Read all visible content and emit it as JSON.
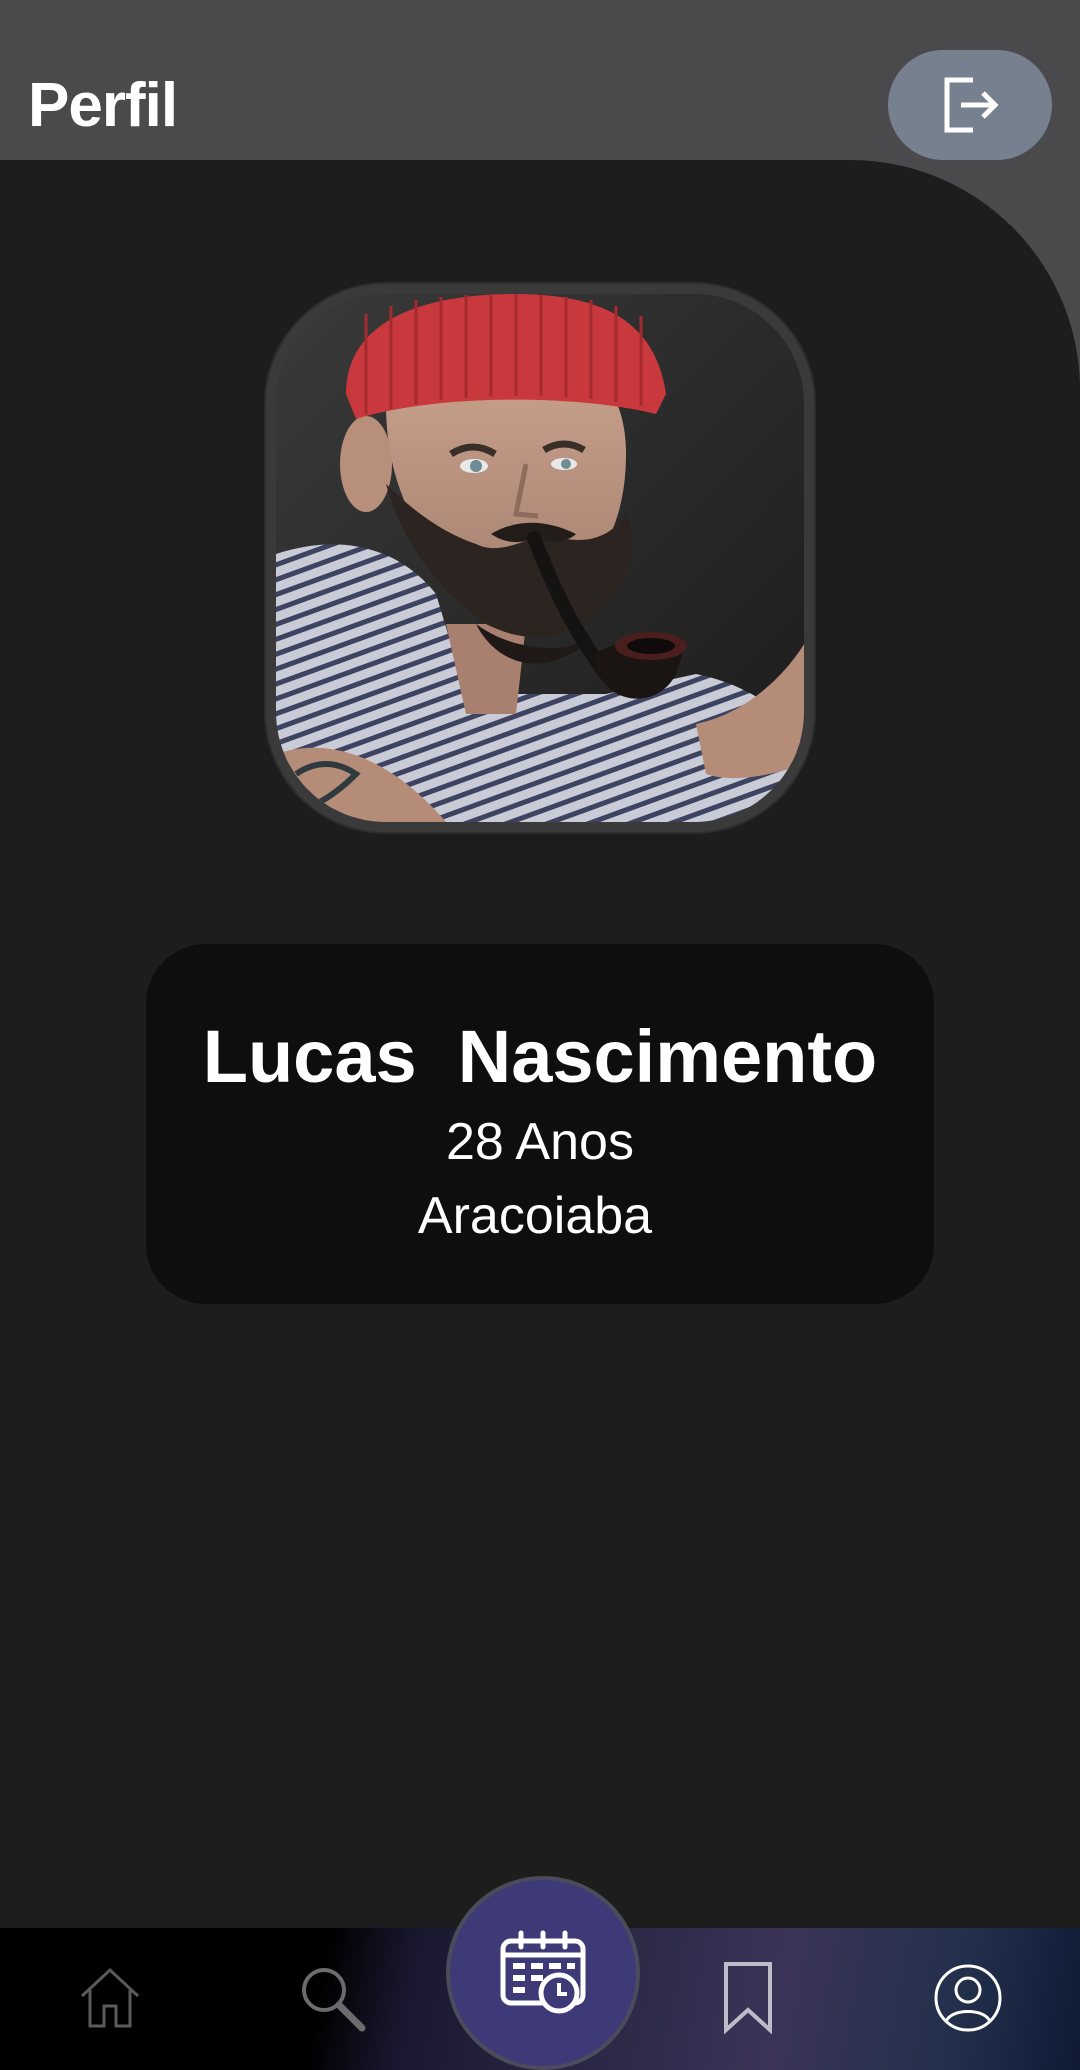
{
  "header": {
    "title": "Perfil",
    "logout_icon": "logout-icon"
  },
  "profile": {
    "name": "Lucas  Nascimento",
    "age": "28 Anos",
    "city": "Aracoiaba",
    "avatar_alt": "profile-photo"
  },
  "nav": {
    "items": [
      {
        "icon": "home-icon"
      },
      {
        "icon": "search-icon"
      },
      {
        "icon": "calendar-clock-icon"
      },
      {
        "icon": "bookmark-icon"
      },
      {
        "icon": "user-icon"
      }
    ]
  },
  "colors": {
    "header_bg": "#4a4a4c",
    "panel_bg": "#1d1d1d",
    "card_bg": "#0e0e0e",
    "logout_bg": "#76808e",
    "fab_bg": "#3e3a78"
  }
}
